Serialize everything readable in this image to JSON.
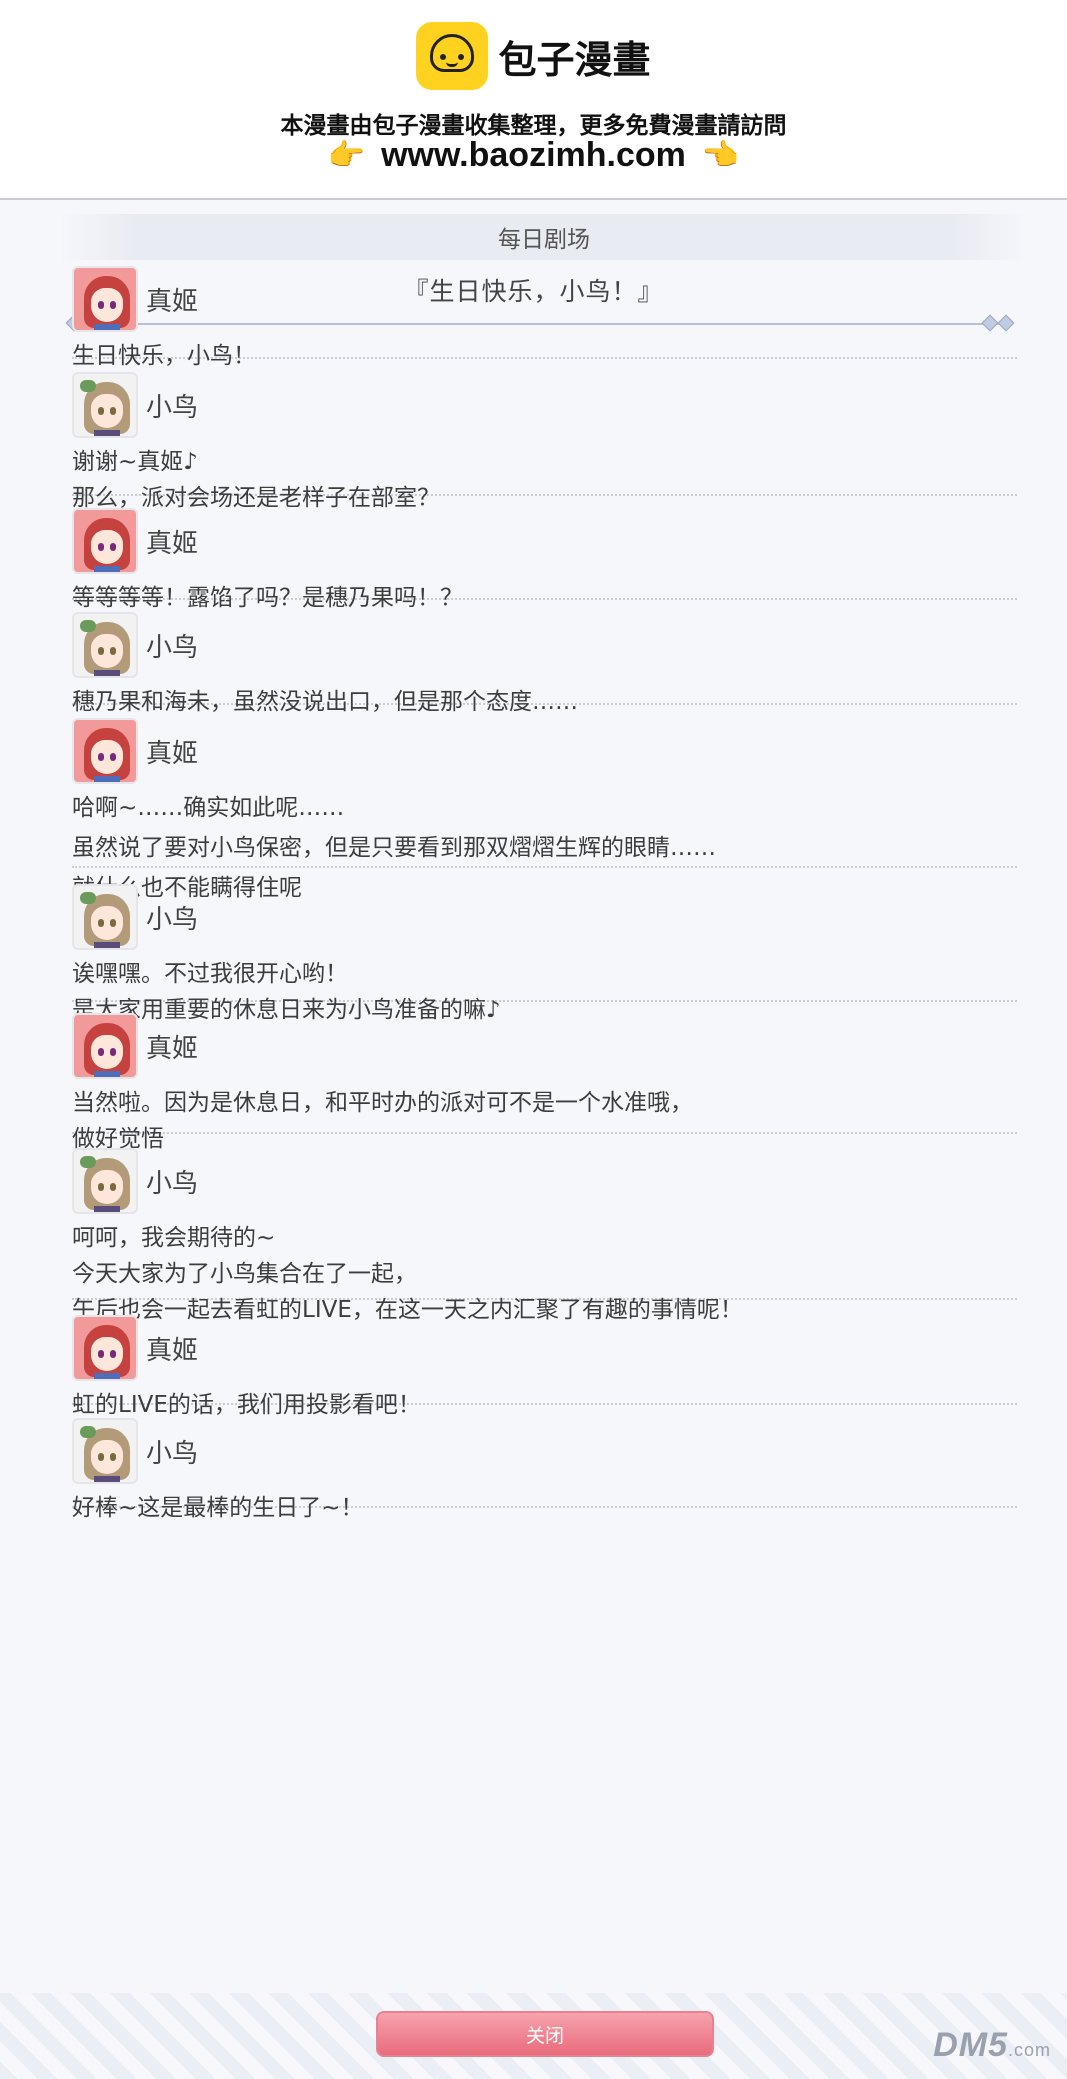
{
  "watermark": {
    "brand": "包子漫畫",
    "note": "本漫畫由包子漫畫收集整理，更多免費漫畫請訪問",
    "hand_left": "👉",
    "url": "www.baozimh.com",
    "hand_right": "👈"
  },
  "dialog": {
    "header": "每日剧场",
    "story_title": "『生日快乐，小鸟！』",
    "close_label": "关闭",
    "site_badge": "DM5",
    "site_badge_suffix": ".com"
  },
  "messages": [
    {
      "speaker": "真姬",
      "avatar": "maki",
      "lines": [
        "生日快乐，小鸟！"
      ]
    },
    {
      "speaker": "小鸟",
      "avatar": "kotori",
      "lines": [
        "谢谢~真姬♪",
        "那么，派对会场还是老样子在部室？"
      ]
    },
    {
      "speaker": "真姬",
      "avatar": "maki",
      "lines": [
        "等等等等！露馅了吗？是穗乃果吗！？"
      ]
    },
    {
      "speaker": "小鸟",
      "avatar": "kotori",
      "lines": [
        "穗乃果和海未，虽然没说出口，但是那个态度……"
      ]
    },
    {
      "speaker": "真姬",
      "avatar": "maki",
      "lines": [
        "哈啊~……确实如此呢……",
        "虽然说了要对小鸟保密，但是只要看到那双熠熠生辉的眼睛……",
        "就什么也不能瞒得住呢"
      ]
    },
    {
      "speaker": "小鸟",
      "avatar": "kotori",
      "lines": [
        "诶嘿嘿。不过我很开心哟！",
        "是大家用重要的休息日来为小鸟准备的嘛♪"
      ]
    },
    {
      "speaker": "真姬",
      "avatar": "maki",
      "lines": [
        "当然啦。因为是休息日，和平时办的派对可不是一个水准哦，",
        "做好觉悟"
      ]
    },
    {
      "speaker": "小鸟",
      "avatar": "kotori",
      "lines": [
        "呵呵，我会期待的~",
        "今天大家为了小鸟集合在了一起，",
        "午后也会一起去看虹的LIVE，在这一天之内汇聚了有趣的事情呢！"
      ]
    },
    {
      "speaker": "真姬",
      "avatar": "maki",
      "lines": [
        "虹的LIVE的话，我们用投影看吧！"
      ]
    },
    {
      "speaker": "小鸟",
      "avatar": "kotori",
      "lines": [
        "好棒~这是最棒的生日了~！"
      ]
    }
  ]
}
